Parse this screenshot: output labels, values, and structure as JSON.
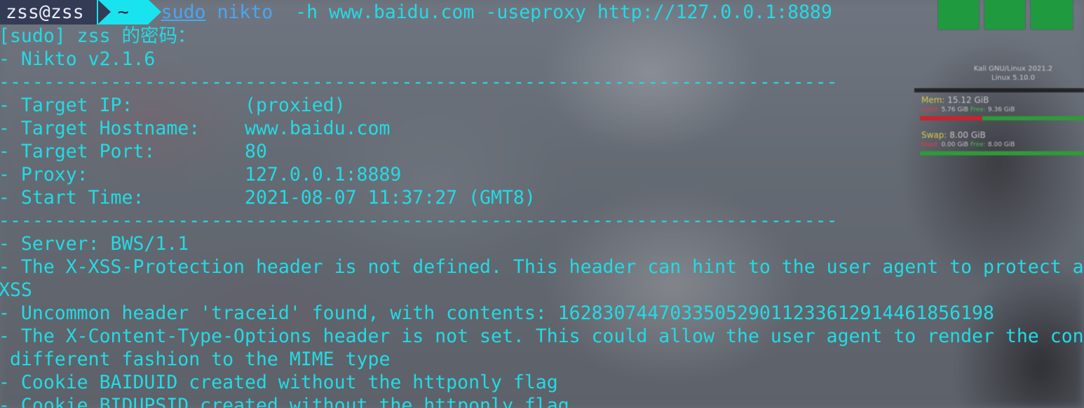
{
  "prompt": {
    "user_host": "zss@zss",
    "dir": "~",
    "cmd_sudo": "sudo",
    "cmd_name": "nikto",
    "cmd_args": "  -h www.baidu.com -useproxy http://127.0.0.1:8889"
  },
  "output": {
    "sudo_prompt": "[sudo] zss 的密码：",
    "version": "- Nikto v2.1.6",
    "separator": "---------------------------------------------------------------------------",
    "target_ip": "- Target IP:          (proxied)",
    "target_hostname": "- Target Hostname:    www.baidu.com",
    "target_port": "- Target Port:        80",
    "proxy": "- Proxy:              127.0.0.1:8889",
    "start_time": "- Start Time:         2021-08-07 11:37:27 (GMT8)",
    "separator2": "---------------------------------------------------------------------------",
    "server": "- Server: BWS/1.1",
    "xss_1": "- The X-XSS-Protection header is not defined. This header can hint to the user agent to protect ag",
    "xss_2": "XSS",
    "traceid": "- Uncommon header 'traceid' found, with contents: 16283074470335052901123361291446185619​8",
    "xcto_1": "- The X-Content-Type-Options header is not set. This could allow the user agent to render the cont",
    "xcto_2": " different fashion to the MIME type",
    "cookie_baiduid": "- Cookie BAIDUID created without the httponly flag",
    "cookie_bidupsid": "- Cookie BIDUPSID created without the httponly flag"
  },
  "widget": {
    "system_line1": "Kali GNU/Linux 2021.2",
    "system_line2": "Linux 5.10.0",
    "mem_label": "Mem:",
    "mem_total": "15.12 GiB",
    "mem_used_label": "Used:",
    "mem_used": "5.76 GiB",
    "mem_free_label": "Free:",
    "mem_free": "9.36 GiB",
    "mem_used_fraction": 0.38,
    "swap_label": "Swap:",
    "swap_total": "8.00 GiB",
    "swap_used_label": "Used:",
    "swap_used": "0.00 GiB",
    "swap_free_label": "Free:",
    "swap_free": "8.00 GiB",
    "swap_used_fraction": 0.0
  },
  "colors": {
    "terminal_text": "#22dbe4",
    "prompt_user_bg": "#343b55",
    "prompt_dir_bg": "#19e3ee",
    "command": "#49a6f0",
    "workspace_green": "#1f9a3f"
  }
}
